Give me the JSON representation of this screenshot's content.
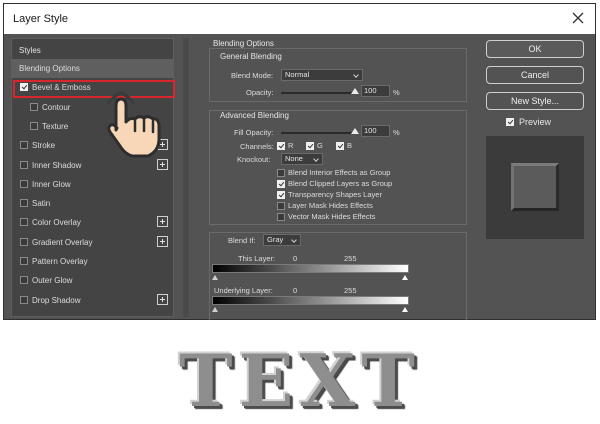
{
  "window": {
    "title": "Layer Style"
  },
  "styles_panel": {
    "header": "Styles",
    "items": [
      {
        "label": "Blending Options",
        "checkbox": false,
        "checked": false,
        "plus": false,
        "indent": false,
        "selected": true
      },
      {
        "label": "Bevel & Emboss",
        "checkbox": true,
        "checked": true,
        "plus": false,
        "indent": false,
        "selected": false
      },
      {
        "label": "Contour",
        "checkbox": true,
        "checked": false,
        "plus": false,
        "indent": true,
        "selected": false
      },
      {
        "label": "Texture",
        "checkbox": true,
        "checked": false,
        "plus": false,
        "indent": true,
        "selected": false
      },
      {
        "label": "Stroke",
        "checkbox": true,
        "checked": false,
        "plus": true,
        "indent": false,
        "selected": false
      },
      {
        "label": "Inner Shadow",
        "checkbox": true,
        "checked": false,
        "plus": true,
        "indent": false,
        "selected": false
      },
      {
        "label": "Inner Glow",
        "checkbox": true,
        "checked": false,
        "plus": false,
        "indent": false,
        "selected": false
      },
      {
        "label": "Satin",
        "checkbox": true,
        "checked": false,
        "plus": false,
        "indent": false,
        "selected": false
      },
      {
        "label": "Color Overlay",
        "checkbox": true,
        "checked": false,
        "plus": true,
        "indent": false,
        "selected": false
      },
      {
        "label": "Gradient Overlay",
        "checkbox": true,
        "checked": false,
        "plus": true,
        "indent": false,
        "selected": false
      },
      {
        "label": "Pattern Overlay",
        "checkbox": true,
        "checked": false,
        "plus": false,
        "indent": false,
        "selected": false
      },
      {
        "label": "Outer Glow",
        "checkbox": true,
        "checked": false,
        "plus": false,
        "indent": false,
        "selected": false
      },
      {
        "label": "Drop Shadow",
        "checkbox": true,
        "checked": false,
        "plus": true,
        "indent": false,
        "selected": false
      }
    ]
  },
  "blending": {
    "title": "Blending Options",
    "general": {
      "title": "General Blending",
      "blend_mode_label": "Blend Mode:",
      "blend_mode_value": "Normal",
      "opacity_label": "Opacity:",
      "opacity_value": "100",
      "opacity_unit": "%",
      "opacity_level": 1.0
    },
    "advanced": {
      "title": "Advanced Blending",
      "fill_opacity_label": "Fill Opacity:",
      "fill_opacity_value": "100",
      "fill_opacity_unit": "%",
      "fill_opacity_level": 1.0,
      "channels_label": "Channels:",
      "channel_r": "R",
      "channel_g": "G",
      "channel_b": "B",
      "knockout_label": "Knockout:",
      "knockout_value": "None",
      "options": [
        {
          "label": "Blend Interior Effects as Group",
          "checked": false
        },
        {
          "label": "Blend Clipped Layers as Group",
          "checked": true
        },
        {
          "label": "Transparency Shapes Layer",
          "checked": true
        },
        {
          "label": "Layer Mask Hides Effects",
          "checked": false
        },
        {
          "label": "Vector Mask Hides Effects",
          "checked": false
        }
      ]
    },
    "blend_if": {
      "label": "Blend If:",
      "value": "Gray",
      "this_layer_label": "This Layer:",
      "this_layer_min": "0",
      "this_layer_max": "255",
      "underlying_label": "Underlying Layer:",
      "underlying_min": "0",
      "underlying_max": "255"
    }
  },
  "buttons": {
    "ok": "OK",
    "cancel": "Cancel",
    "new_style": "New Style..."
  },
  "preview": {
    "label": "Preview",
    "checked": true
  },
  "sample_text": "TEXT",
  "colors": {
    "dialog_bg": "#535353",
    "highlight_border": "#d9252c",
    "hand_fill": "#f7d7b8"
  }
}
